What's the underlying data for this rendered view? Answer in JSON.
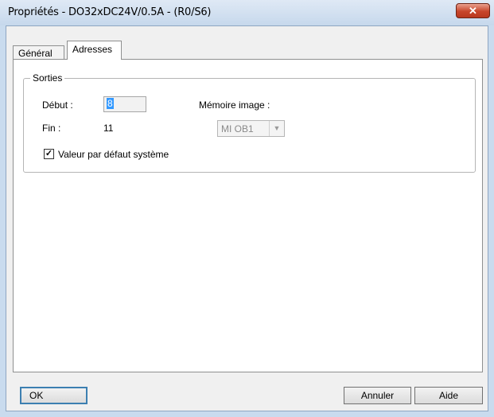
{
  "window": {
    "title": "Propriétés - DO32xDC24V/0.5A - (R0/S6)",
    "close_glyph": "✕"
  },
  "tabs": [
    {
      "label": "Général",
      "active": false
    },
    {
      "label": "Adresses",
      "active": true
    }
  ],
  "outputs_group": {
    "title": "Sorties",
    "start_label": "Début :",
    "start_value": "8",
    "end_label": "Fin :",
    "end_value": "11",
    "memory_label": "Mémoire image :",
    "memory_value": "MI OB1",
    "default_checkbox_label": "Valeur par défaut système",
    "default_checked": true
  },
  "buttons": {
    "ok": "OK",
    "cancel": "Annuler",
    "help": "Aide"
  },
  "colors": {
    "titlebar": "#c6d8ec",
    "close_button": "#c7452a",
    "selection": "#3399ff"
  }
}
